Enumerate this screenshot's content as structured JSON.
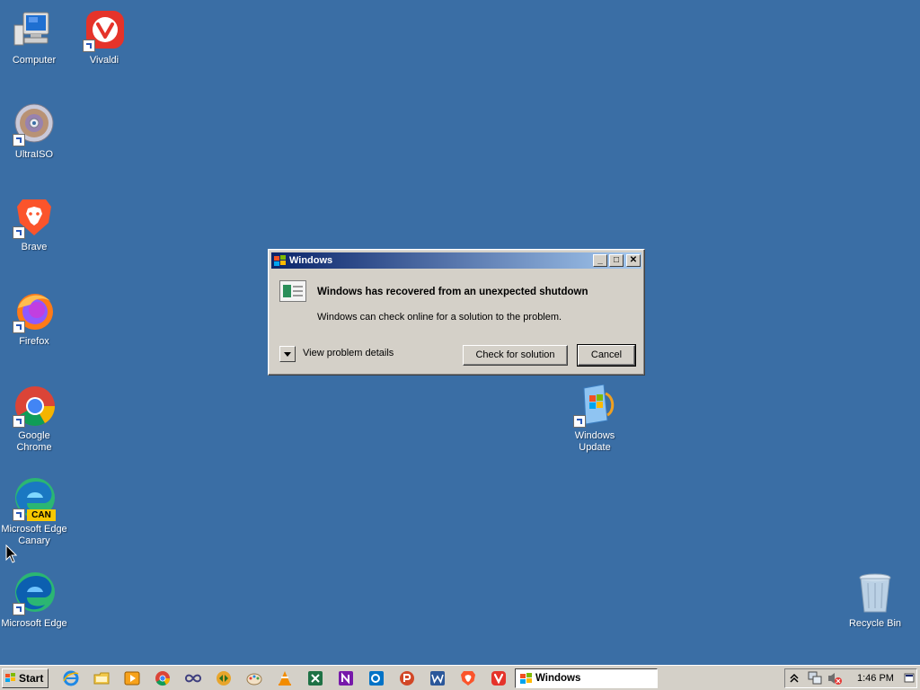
{
  "desktop": {
    "icons": [
      {
        "label": "Computer",
        "icon": "computer-icon"
      },
      {
        "label": "Vivaldi",
        "icon": "vivaldi-icon"
      },
      {
        "label": "UltraISO",
        "icon": "ultraiso-icon"
      },
      {
        "label": "Brave",
        "icon": "brave-icon"
      },
      {
        "label": "Firefox",
        "icon": "firefox-icon"
      },
      {
        "label": "Google Chrome",
        "icon": "chrome-icon"
      },
      {
        "label": "Microsoft Edge Canary",
        "icon": "edge-canary-icon",
        "badge": "CAN"
      },
      {
        "label": "Microsoft Edge",
        "icon": "edge-icon"
      },
      {
        "label": "Windows Update",
        "icon": "windows-update-icon"
      },
      {
        "label": "Recycle Bin",
        "icon": "recycle-bin-icon"
      }
    ]
  },
  "dialog": {
    "title": "Windows",
    "heading": "Windows has recovered from an unexpected shutdown",
    "message": "Windows can check online for a solution to the problem.",
    "details_label": "View problem details",
    "check_button": "Check for solution",
    "cancel_button": "Cancel",
    "title_buttons": [
      "_",
      "□",
      "✕"
    ]
  },
  "taskbar": {
    "start_label": "Start",
    "quick_launch": [
      "ie-icon",
      "explorer-icon",
      "media-player-icon",
      "chrome-icon",
      "infinity-icon",
      "winamp-icon",
      "paint-icon",
      "vlc-icon",
      "excel-icon",
      "onenote-icon",
      "outlook-icon",
      "powerpoint-icon",
      "word-icon",
      "brave-icon",
      "vivaldi-icon"
    ],
    "task_label": "Windows",
    "clock": "1:46 PM"
  },
  "colors": {
    "desktop": "#3a6ea5",
    "titlebar_start": "#0a246a",
    "titlebar_end": "#a6caf0",
    "face": "#d4d0c8"
  }
}
